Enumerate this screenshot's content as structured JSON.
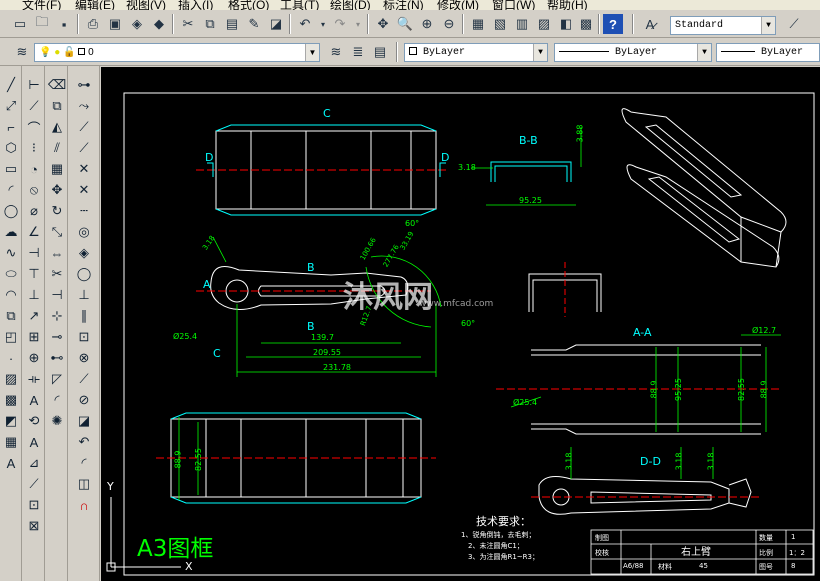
{
  "menu": [
    "文件(F)",
    "编辑(E)",
    "视图(V)",
    "插入(I)",
    "格式(O)",
    "工具(T)",
    "绘图(D)",
    "标注(N)",
    "修改(M)",
    "窗口(W)",
    "帮助(H)"
  ],
  "toolbar": {
    "text_style": "Standard",
    "layer_name": "0",
    "color": "ByLayer",
    "linetype": "ByLayer",
    "lineweight": "ByLayer"
  },
  "drawing": {
    "frame_label": "A3图框",
    "views": {
      "c": "C",
      "d_left": "D",
      "d_right": "D",
      "bb": "B-B",
      "aa": "A-A",
      "dd": "D-D",
      "b_top": "B",
      "b_bottom": "B",
      "a": "A",
      "c_bottom": "C"
    },
    "dimensions": {
      "d139": "139.7",
      "d209": "209.55",
      "d231": "231.78",
      "d95": "95.25",
      "d318a": "3.18",
      "d318b": "3.18",
      "d254a": "Ø25.4",
      "d254b": "Ø25.4",
      "d127": "Ø12.7",
      "d889a": "88.9",
      "d889b": "88.9",
      "d889c": "88.9",
      "d8255a": "82.55",
      "d8255b": "82.55",
      "d9525v": "95.25",
      "d60a": "60°",
      "d60b": "60°",
      "dr": "R12.7",
      "dd318a": "3.18",
      "dd318b": "3.18",
      "dd318c": "3.18",
      "d100": "100.66",
      "d277": "277.76",
      "d3319": "33.19",
      "d388": "3.88"
    },
    "notes": {
      "title": "技术要求：",
      "n1": "1、锐角倒钝，去毛刺；",
      "n2": "2、未注圆角C1；",
      "n3": "3、为注圆角R1~R3；"
    },
    "titleblock": {
      "draw": "制图",
      "check": "校核",
      "part": "右上臂",
      "qty": "数量",
      "qty_v": "1",
      "scale": "比例",
      "scale_v": "1：2",
      "fig": "图号",
      "fig_v": "8",
      "material": "材料",
      "material_v": "45",
      "wt": "A6/88"
    },
    "ucs": {
      "x": "X",
      "y": "Y"
    },
    "watermark": {
      "name": "沐风网",
      "url": "www.mfcad.com"
    }
  }
}
